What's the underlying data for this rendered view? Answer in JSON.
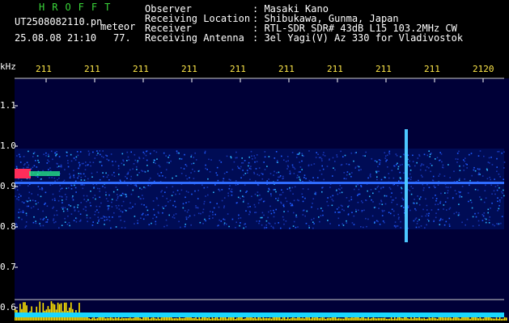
{
  "header": {
    "logo": "HROFFT",
    "filename": "UT2508082110.pn",
    "tag": "meteor",
    "datetime": "25.08.08 21:10",
    "value": "77.",
    "observer_label": "Observer",
    "observer": ": Masaki Kano",
    "location_label": "Receiving Location",
    "location": ": Shibukawa, Gunma, Japan",
    "receiver_label": "Receiver",
    "receiver": ": RTL-SDR SDR# 43dB L15 103.2MHz CW",
    "antenna_label": "Receiving Antenna",
    "antenna": ": 3el Yagi(V) Az 330 for Vladivostok"
  },
  "axis": {
    "unit": "kHz",
    "x_ticks": [
      "211",
      "211",
      "211",
      "211",
      "211",
      "211",
      "211",
      "211",
      "211",
      "2120"
    ],
    "y_ticks": [
      "1.1",
      "1.0",
      "0.9",
      "0.8",
      "0.7",
      "0.6"
    ]
  },
  "colors": {
    "logo": "#3ad63a",
    "ticks": "#ffe84a",
    "signal": "#2f6cff",
    "bar": "#ffe400",
    "base": "#19d7ff"
  }
}
